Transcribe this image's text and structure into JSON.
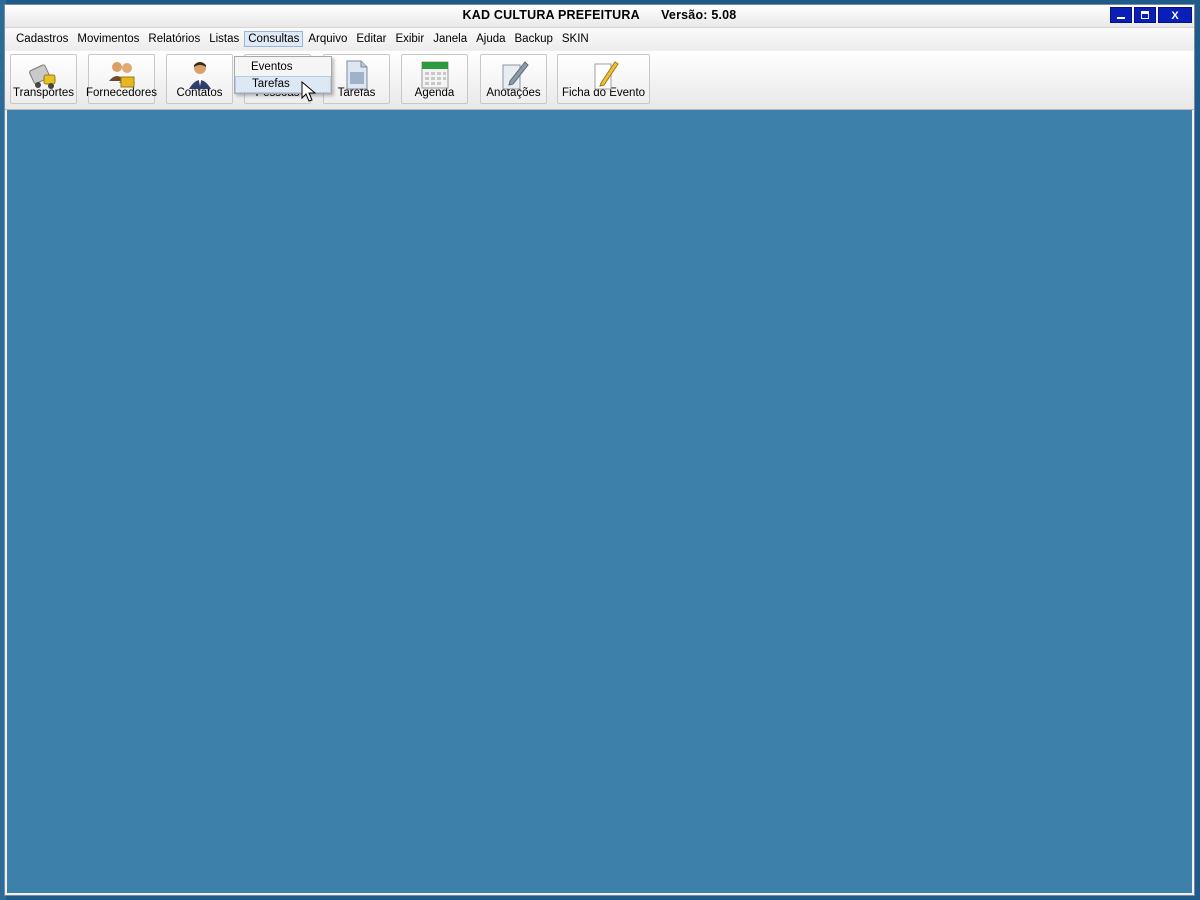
{
  "window": {
    "title": "KAD CULTURA PREFEITURA",
    "version": "Versão: 5.08",
    "close_glyph": "X"
  },
  "menu": {
    "items": [
      "Cadastros",
      "Movimentos",
      "Relatórios",
      "Listas",
      "Consultas",
      "Arquivo",
      "Editar",
      "Exibir",
      "Janela",
      "Ajuda",
      "Backup",
      "SKIN"
    ],
    "active": "Consultas"
  },
  "toolbar": {
    "buttons": [
      {
        "label": "Transportes",
        "icon": "truck-icon"
      },
      {
        "label": "Fornecedores",
        "icon": "suppliers-icon"
      },
      {
        "label": "Contatos",
        "icon": "contact-person-icon"
      },
      {
        "label": "Pessoas",
        "icon": "people-icon"
      },
      {
        "label": "Tarefas",
        "icon": "document-icon"
      },
      {
        "label": "Agenda",
        "icon": "calendar-icon"
      },
      {
        "label": "Anotações",
        "icon": "notes-pen-icon"
      },
      {
        "label": "Ficha do Evento",
        "icon": "pencil-paper-icon"
      }
    ]
  },
  "dropdown": {
    "items": [
      "Eventos",
      "Tarefas"
    ],
    "hovered": "Tarefas"
  },
  "colors": {
    "client_bg": "#3d81ab",
    "title_buttons": "#0a1fb8"
  }
}
